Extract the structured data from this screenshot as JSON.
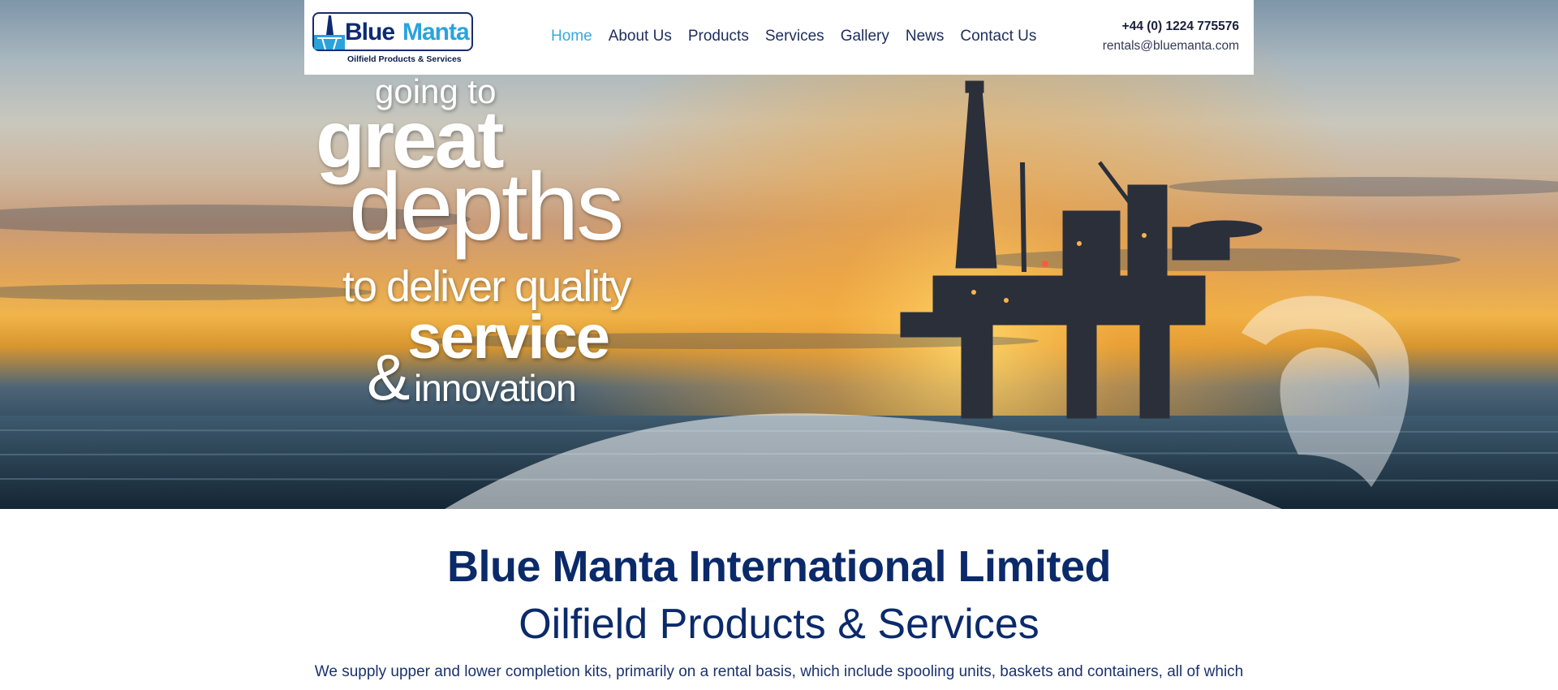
{
  "brand": {
    "name_part1": "Blue",
    "name_part2": "Manta",
    "tagline": "Oilfield Products & Services"
  },
  "nav": {
    "items": [
      {
        "label": "Home",
        "active": true
      },
      {
        "label": "About Us",
        "active": false
      },
      {
        "label": "Products",
        "active": false
      },
      {
        "label": "Services",
        "active": false
      },
      {
        "label": "Gallery",
        "active": false
      },
      {
        "label": "News",
        "active": false
      },
      {
        "label": "Contact Us",
        "active": false
      }
    ]
  },
  "contact": {
    "phone": "+44 (0) 1224 775576",
    "email": "rentals@bluemanta.com"
  },
  "hero": {
    "line1": "going to",
    "line2": "great",
    "line3": "depths",
    "line4": "to deliver quality",
    "line5": "service",
    "line6": "&",
    "line7": "innovation"
  },
  "main": {
    "title": "Blue Manta International Limited",
    "subtitle": "Oilfield Products & Services",
    "intro": "We supply upper and lower completion kits, primarily on a rental basis, which include spooling units, baskets and containers, all of which"
  },
  "colors": {
    "primary": "#0b2a6a",
    "accent": "#3aa8dc",
    "nav_text": "#1d2d5c"
  }
}
